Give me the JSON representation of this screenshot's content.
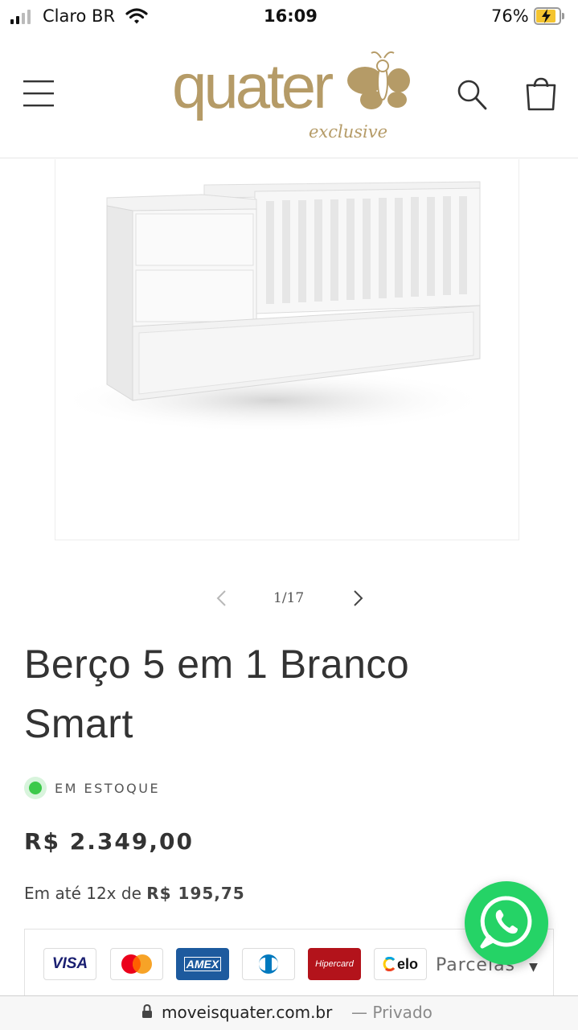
{
  "status_bar": {
    "carrier": "Claro BR",
    "time": "16:09",
    "battery": "76%"
  },
  "header": {
    "logo_text": "quater",
    "logo_subtext": "exclusive"
  },
  "gallery": {
    "counter": "1/17"
  },
  "product": {
    "title_line1": "Berço 5 em 1 Branco",
    "title_line2": "Smart",
    "stock_status": "EM ESTOQUE",
    "price": "R$ 2.349,00",
    "installment_prefix": "Em até 12x de",
    "installment_value": "R$ 195,75"
  },
  "payment": {
    "methods": [
      "VISA",
      "Mastercard",
      "AMEX",
      "Diners",
      "Hipercard",
      "elo"
    ],
    "installments_label": "Parcelas"
  },
  "browser": {
    "url": "moveisquater.com.br",
    "privacy": "— Privado"
  },
  "colors": {
    "brand_gold": "#b59b67",
    "stock_green": "#3cc94a",
    "whatsapp_green": "#25d366"
  }
}
